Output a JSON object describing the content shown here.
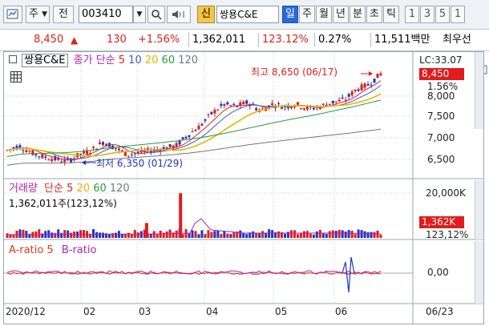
{
  "toolbar": {
    "period_button": "주",
    "chart_button": "전",
    "stock_code": "003410",
    "credit_badge": "신",
    "stock_name": "쌍용C&E",
    "tabs": [
      "일",
      "주",
      "월",
      "년",
      "분",
      "초",
      "틱"
    ],
    "periods": [
      "1",
      "3",
      "5",
      "1"
    ],
    "active_tab_index": 0
  },
  "quote": {
    "price": "8,450",
    "change": "130",
    "change_pct": "+1.56%",
    "volume": "1,362,011",
    "volume_ratio": "123.12%",
    "turnover": "0.27%",
    "amount": "11,511백만",
    "priority_label": "최우선"
  },
  "price_panel": {
    "legend_name": "쌍용C&E",
    "legend_ma_prefix": "종가 단순",
    "ma_periods": [
      "5",
      "10",
      "20",
      "60",
      "120"
    ],
    "ma_colors": [
      "#e02323",
      "#3a5ad8",
      "#e8b400",
      "#2a9a3a",
      "#777777"
    ],
    "lc_label": "LC:33.07",
    "price_tag": "8,450",
    "pct_tag": "1.56%",
    "high_label": "최고 8,650 (06/17)",
    "low_label": "최저 6,350 (01/29)",
    "y_ticks": [
      "8,000",
      "7,500",
      "7,000",
      "6,500"
    ]
  },
  "volume_panel": {
    "legend_title": "거래량",
    "legend_ma_prefix": "단순",
    "ma_periods": [
      "5",
      "20",
      "60",
      "120"
    ],
    "value_line": "1,362,011주(123,12%)",
    "y_tick": "20,000K",
    "vol_tag": "1,362K",
    "pct_tag": "123,12%"
  },
  "ratio_panel": {
    "a_label": "A-ratio 5",
    "b_label": "B-ratio",
    "y_tick": "0,00"
  },
  "x_axis": {
    "labels": [
      "2020/12",
      "02",
      "03",
      "04",
      "05",
      "06"
    ],
    "end_label": "06/23"
  },
  "chart_data": {
    "type": "line",
    "title": "쌍용C&E",
    "ylim": [
      6200,
      8800
    ],
    "high": 8650,
    "low": 6350,
    "series": [
      {
        "name": "종가",
        "values": [
          6700,
          6800,
          6650,
          6550,
          6500,
          6450,
          6600,
          6700,
          6900,
          6750,
          6600,
          6650,
          6700,
          6750,
          6800,
          7050,
          7250,
          7550,
          7750,
          7700,
          7800,
          7600,
          7750,
          7700,
          7750,
          7650,
          7700,
          7800,
          7850,
          8100,
          8200,
          8450
        ]
      }
    ],
    "volume_spikes": [
      {
        "x": 0.46,
        "value": 18000
      },
      {
        "x": 0.37,
        "value": 6000
      }
    ]
  }
}
